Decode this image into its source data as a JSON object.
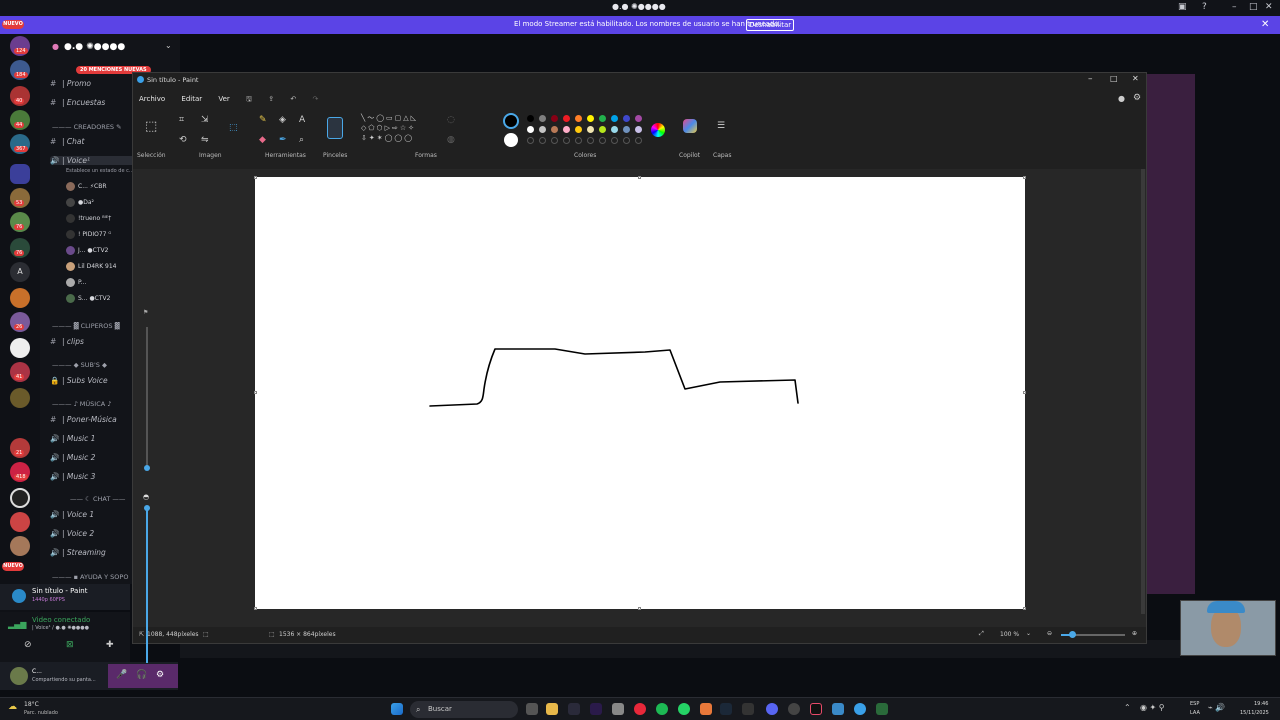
{
  "topbar": {
    "title": "●.● ✺●●●●"
  },
  "streamer": {
    "message": "El modo Streamer está habilitado. Los nombres de usuario se han truncado.",
    "button": "Deshabilitar"
  },
  "rail": {
    "nuevo_top": "NUEVO",
    "nuevo_bottom": "NUEVO",
    "badges": [
      "124",
      "184",
      "40",
      "44",
      "367",
      "53",
      "76",
      "76",
      "A",
      "26",
      "41",
      "21",
      "418"
    ]
  },
  "channels": {
    "server_name": "●.● ✺●●●●",
    "mentions_pill": "20 MENCIONES NUEVAS",
    "items": [
      {
        "icon": "#",
        "label": "| Promo"
      },
      {
        "icon": "#",
        "label": "| Encuestas"
      },
      {
        "icon": "#",
        "label": "| Chat"
      },
      {
        "icon": "🔊",
        "label": "| Voice¹"
      },
      {
        "icon": "#",
        "label": "| clips"
      },
      {
        "icon": "🔒",
        "label": "| Subs Voice"
      },
      {
        "icon": "#",
        "label": "| Poner-Música"
      },
      {
        "icon": "🔊",
        "label": "| Music 1"
      },
      {
        "icon": "🔊",
        "label": "| Music 2"
      },
      {
        "icon": "🔊",
        "label": "| Music 3"
      },
      {
        "icon": "🔊",
        "label": "| Voice 1"
      },
      {
        "icon": "🔊",
        "label": "| Voice 2"
      },
      {
        "icon": "🔊",
        "label": "| Streaming"
      }
    ],
    "categories": [
      "CREADORES",
      "CLIPEROS",
      "SUB'S",
      "MÚSICA",
      "CHAT",
      "AYUDA Y SOPO"
    ],
    "voice_status_hint": "Establece un estado de c...",
    "users": [
      "C... ⚡CBR",
      "●Da²",
      "!trueno ᴮᴵᴱ†",
      "! PIDIO77 ᴳ",
      "J... ●CTV2",
      "Lil D4RK 914",
      "P...",
      "S... ●CTV2"
    ]
  },
  "activity": {
    "title": "Sin título - Paint",
    "subtitle": "1440p 60FPS"
  },
  "voice": {
    "status": "Video conectado",
    "channel": "| Voice¹ / ●.● ✺●●●●"
  },
  "user": {
    "name": "C...",
    "status": "Compartiendo su panta..."
  },
  "paint": {
    "title": "Sin título - Paint",
    "menus": [
      "Archivo",
      "Editar",
      "Ver"
    ],
    "groups": [
      "Selección",
      "Imagen",
      "Herramientas",
      "Pinceles",
      "Formas",
      "Colores",
      "Copilot",
      "Capas"
    ],
    "colors": {
      "row1": [
        "#000000",
        "#7f7f7f",
        "#880015",
        "#ed1c24",
        "#ff7f27",
        "#fff200",
        "#22b14c",
        "#00a2e8",
        "#3f48cc",
        "#a349a4"
      ],
      "row2": [
        "#ffffff",
        "#c3c3c3",
        "#b97a57",
        "#ffaec9",
        "#ffc90e",
        "#efe4b0",
        "#b5e61d",
        "#99d9ea",
        "#7092be",
        "#c8bfe7"
      ]
    },
    "status_cursor": "1088, 448píxeles",
    "status_size": "1536 × 864píxeles",
    "zoom": "100 %"
  },
  "taskbar": {
    "weather_temp": "18°C",
    "weather_desc": "Parc. nublado",
    "search": "Buscar",
    "lang": "ESP",
    "lang2": "LAA",
    "time": "19:46",
    "date": "15/11/2025"
  }
}
